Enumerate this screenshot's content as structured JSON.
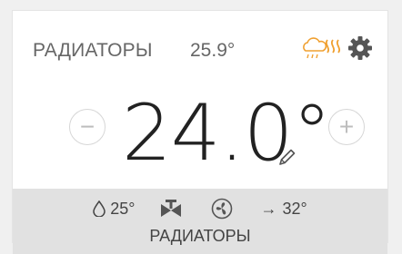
{
  "header": {
    "title": "РАДИАТОРЫ",
    "current_temp": "25.9°"
  },
  "main": {
    "target_temp": "24.0°",
    "minus_label": "−",
    "plus_label": "+"
  },
  "footer": {
    "humidity": "25°",
    "flow_temp": "32°",
    "arrow": "→",
    "label": "РАДИАТОРЫ"
  },
  "icons": {
    "heat": "heating-icon",
    "settings": "gear-icon",
    "edit": "pencil-icon",
    "humidity": "drop-icon",
    "valve": "valve-icon",
    "fan": "fan-icon"
  },
  "colors": {
    "heat_accent": "#f0a030",
    "icon_gray": "#555555"
  }
}
